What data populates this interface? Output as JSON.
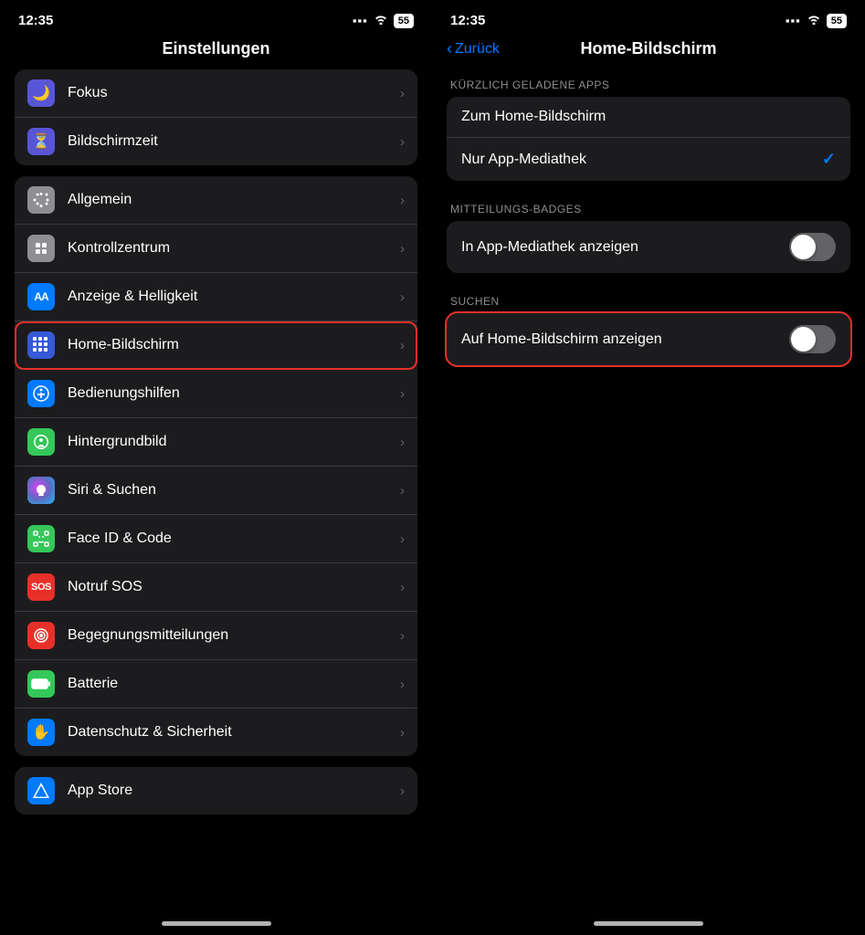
{
  "left": {
    "statusBar": {
      "time": "12:35",
      "battery": "55"
    },
    "pageTitle": "Einstellungen",
    "sections": [
      {
        "id": "top-section",
        "items": [
          {
            "id": "fokus",
            "label": "Fokus",
            "iconClass": "icon-fokus",
            "iconType": "moon"
          },
          {
            "id": "bildschirmzeit",
            "label": "Bildschirmzeit",
            "iconClass": "icon-bildschirmzeit",
            "iconType": "hourglass"
          }
        ]
      },
      {
        "id": "mid-section",
        "items": [
          {
            "id": "allgemein",
            "label": "Allgemein",
            "iconClass": "icon-allgemein",
            "iconType": "gear"
          },
          {
            "id": "kontrollzentrum",
            "label": "Kontrollzentrum",
            "iconClass": "icon-kontrollzentrum",
            "iconType": "ctrl"
          },
          {
            "id": "anzeige",
            "label": "Anzeige & Helligkeit",
            "iconClass": "icon-anzeige",
            "iconType": "aa"
          },
          {
            "id": "home",
            "label": "Home-Bildschirm",
            "iconClass": "icon-home",
            "iconType": "grid",
            "highlighted": true
          },
          {
            "id": "bedienung",
            "label": "Bedienungshilfen",
            "iconClass": "icon-bedienung",
            "iconType": "access"
          },
          {
            "id": "hintergrund",
            "label": "Hintergrundbild",
            "iconClass": "icon-hintergrund",
            "iconType": "flower"
          },
          {
            "id": "siri",
            "label": "Siri & Suchen",
            "iconClass": "icon-siri",
            "iconType": "siri"
          },
          {
            "id": "faceid",
            "label": "Face ID & Code",
            "iconClass": "icon-faceid",
            "iconType": "faceid"
          },
          {
            "id": "notruf",
            "label": "Notruf SOS",
            "iconClass": "icon-notruf",
            "iconType": "sos"
          },
          {
            "id": "begegnung",
            "label": "Begegnungsmitteilungen",
            "iconClass": "icon-begegnung",
            "iconType": "rings"
          },
          {
            "id": "batterie",
            "label": "Batterie",
            "iconClass": "icon-batterie",
            "iconType": "battery"
          },
          {
            "id": "datenschutz",
            "label": "Datenschutz & Sicherheit",
            "iconClass": "icon-datenschutz",
            "iconType": "hand"
          }
        ]
      }
    ],
    "bottomSection": {
      "items": [
        {
          "id": "appstore",
          "label": "App Store",
          "iconClass": "icon-appstore",
          "iconType": "appA"
        }
      ]
    }
  },
  "right": {
    "statusBar": {
      "time": "12:35",
      "battery": "55"
    },
    "backLabel": "Zurück",
    "pageTitle": "Home-Bildschirm",
    "sections": [
      {
        "id": "recently-loaded",
        "header": "KÜRZLICH GELADENE APPS",
        "items": [
          {
            "id": "zum-home",
            "label": "Zum Home-Bildschirm",
            "type": "radio",
            "selected": false
          },
          {
            "id": "nur-app",
            "label": "Nur App-Mediathek",
            "type": "radio",
            "selected": true
          }
        ]
      },
      {
        "id": "mitteilungs-badges",
        "header": "MITTEILUNGS-BADGES",
        "items": [
          {
            "id": "in-app-mediathek",
            "label": "In App-Mediathek anzeigen",
            "type": "toggle",
            "on": false
          }
        ]
      },
      {
        "id": "suchen",
        "header": "SUCHEN",
        "highlighted": true,
        "items": [
          {
            "id": "auf-home",
            "label": "Auf Home-Bildschirm anzeigen",
            "type": "toggle",
            "on": false
          }
        ]
      }
    ]
  }
}
